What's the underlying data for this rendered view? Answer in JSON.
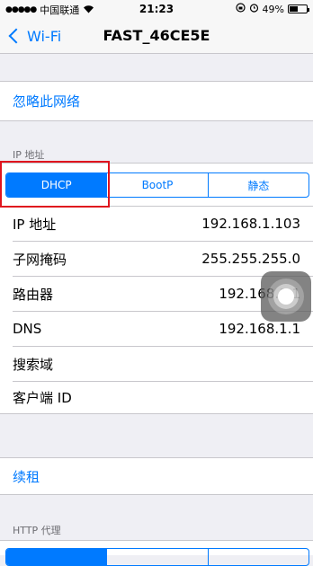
{
  "status": {
    "carrier": "中国联通",
    "time": "21:23",
    "battery_percent": "49%",
    "battery_level": 0.49
  },
  "nav": {
    "back_label": "Wi-Fi",
    "title": "FAST_46CE5E"
  },
  "forget_label": "忽略此网络",
  "ip_section": {
    "header": "IP 地址",
    "segments": [
      "DHCP",
      "BootP",
      "静态"
    ],
    "selected": "DHCP",
    "rows": [
      {
        "label": "IP 地址",
        "value": "192.168.1.103"
      },
      {
        "label": "子网掩码",
        "value": "255.255.255.0"
      },
      {
        "label": "路由器",
        "value": "192.168.1.1"
      },
      {
        "label": "DNS",
        "value": "192.168.1.1"
      },
      {
        "label": "搜索域",
        "value": ""
      },
      {
        "label": "客户端 ID",
        "value": ""
      }
    ]
  },
  "renew_label": "续租",
  "http_section": {
    "header": "HTTP 代理"
  },
  "colors": {
    "accent": "#007aff",
    "highlight": "#e0141e",
    "background": "#efeff4"
  }
}
